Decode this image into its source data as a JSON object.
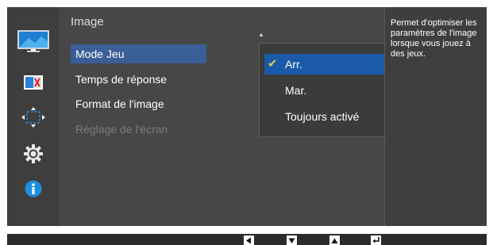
{
  "menu": {
    "title": "Image",
    "items": [
      {
        "label": "Mode Jeu"
      },
      {
        "label": "Temps de réponse"
      },
      {
        "label": "Format de l'image"
      },
      {
        "label": "Réglage de l'écran"
      }
    ],
    "selected_item": "Mode Jeu",
    "disabled_item": "Réglage de l'écran"
  },
  "dropdown": {
    "options": [
      {
        "label": "Arr."
      },
      {
        "label": "Mar."
      },
      {
        "label": "Toujours activé"
      }
    ],
    "selected_option": "Arr."
  },
  "help": {
    "text": "Permet d'optimiser les paramètres de l'image lorsque vous jouez à des jeux."
  },
  "sidebar": {
    "icons": [
      "picture-icon",
      "color-icon",
      "size-position-icon",
      "settings-gear-icon",
      "information-icon"
    ],
    "selected_icon": "picture-icon"
  },
  "bottom_keys": [
    "left-arrow-key-icon",
    "down-arrow-key-icon",
    "up-arrow-key-icon",
    "enter-key-icon"
  ],
  "colors": {
    "selection_blue": "#1a5aa8",
    "menu_selection": "#3a5e98",
    "checkmark": "#d8c85a",
    "info_blue": "#1e8fe0"
  }
}
